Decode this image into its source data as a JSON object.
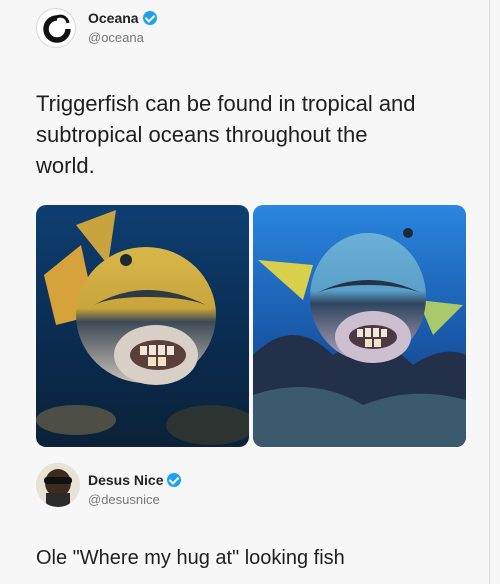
{
  "tweet": {
    "author_name": "Oceana",
    "author_handle": "@oceana",
    "verified": true,
    "text_lines": [
      "Triggerfish can be found in tropical and",
      "subtropical oceans throughout the",
      "world."
    ],
    "media": [
      "triggerfish-photo",
      "triggerfish-photo"
    ]
  },
  "reply": {
    "author_name": "Desus Nice",
    "author_handle": "@desusnice",
    "verified": true,
    "text": "Ole \"Where my hug at\" looking fish"
  },
  "colors": {
    "verified_badge": "#1da1f2",
    "background": "#f7f7f7",
    "water_left": "#0b3560",
    "water_right": "#1d6ec9"
  }
}
